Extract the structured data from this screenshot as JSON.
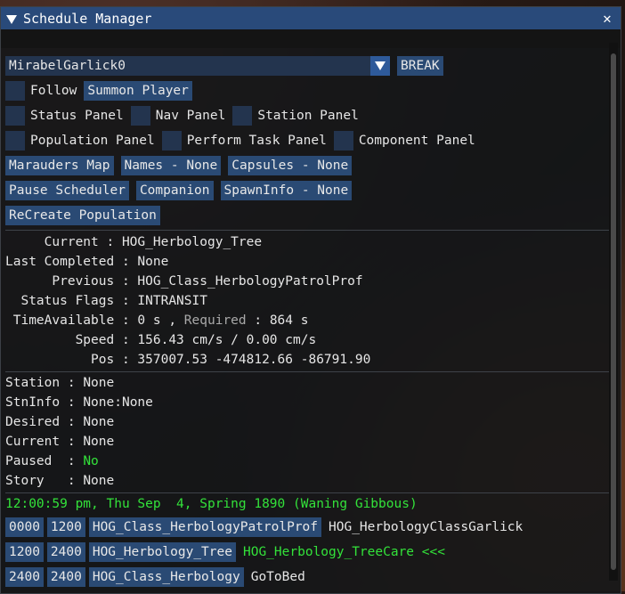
{
  "window": {
    "title": "Schedule Manager",
    "close_glyph": "✕"
  },
  "npc_select": {
    "value": "MirabelGarlick0",
    "break_label": "BREAK"
  },
  "toggles": {
    "follow": "Follow",
    "summon": "Summon Player",
    "status_panel": "Status Panel",
    "nav_panel": "Nav Panel",
    "station_panel": "Station Panel",
    "population_panel": "Population Panel",
    "perform_task_panel": "Perform Task Panel",
    "component_panel": "Component Panel"
  },
  "buttons": {
    "marauders_map": "Marauders Map",
    "names": "Names - None",
    "capsules": "Capsules - None",
    "pause_scheduler": "Pause Scheduler",
    "companion": "Companion",
    "spawn_info": "SpawnInfo - None",
    "recreate_population": "ReCreate Population"
  },
  "status": {
    "current_label": "     Current : ",
    "current": "HOG_Herbology_Tree",
    "last_label": "Last Completed : ",
    "last": "None",
    "previous_label": "      Previous : ",
    "previous": "HOG_Class_HerbologyPatrolProf",
    "flags_label": "  Status Flags : ",
    "flags": "INTRANSIT",
    "time_label": " TimeAvailable : ",
    "time_value": "0 s , ",
    "required_label": "Required",
    "required_value": " : 864 s",
    "speed_label": "         Speed : ",
    "speed": "156.43 cm/s / 0.00 cm/s",
    "pos_label": "           Pos : ",
    "pos": "357007.53 -474812.66 -86791.90"
  },
  "station": {
    "station_label": "Station : ",
    "station": "None",
    "stninfo_label": "StnInfo : ",
    "stninfo": "None:None",
    "desired_label": "Desired : ",
    "desired": "None",
    "current_label": "Current : ",
    "current": "None",
    "paused_label": "Paused  : ",
    "paused": "No",
    "story_label": "Story   : ",
    "story": "None"
  },
  "time_line": "12:00:59 pm, Thu Sep  4, Spring 1890 (Waning Gibbous)",
  "schedule": [
    {
      "start": "0000",
      "end": "1200",
      "activity": "HOG_Class_HerbologyPatrolProf",
      "task": "HOG_HerbologyClassGarlick",
      "current": false
    },
    {
      "start": "1200",
      "end": "2400",
      "activity": "HOG_Herbology_Tree",
      "task": "HOG_Herbology_TreeCare <<<",
      "current": true
    },
    {
      "start": "2400",
      "end": "2400",
      "activity": "HOG_Class_Herbology",
      "task": "GoToBed",
      "current": false
    }
  ],
  "colors": {
    "accent": "#2a4a74",
    "title": "#294a7a",
    "green": "#33e23a"
  }
}
